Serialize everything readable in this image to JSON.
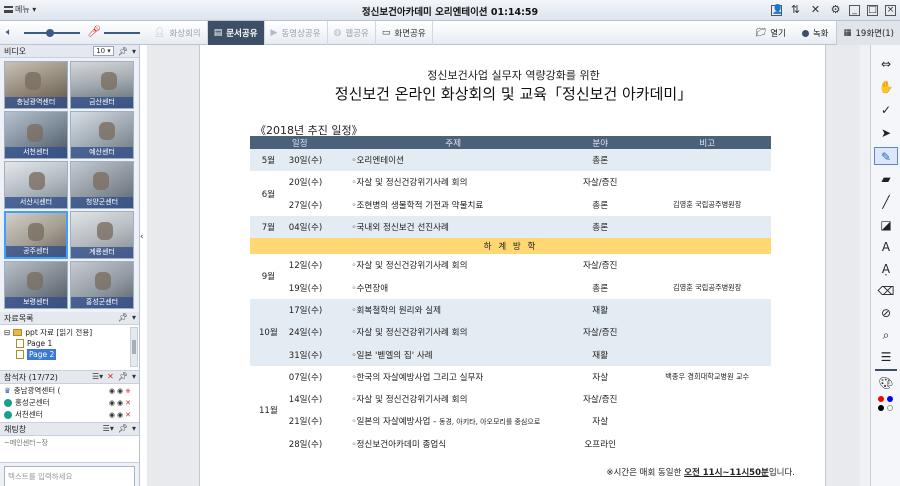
{
  "window": {
    "menu_label": "메뉴",
    "title": "정신보건아카데미 오리엔테이션 01:14:59"
  },
  "toolbar": {
    "tabs": [
      {
        "label": "화상회의",
        "icon": "person-icon"
      },
      {
        "label": "문서공유",
        "icon": "document-icon",
        "active": true
      },
      {
        "label": "동영상공유",
        "icon": "play-icon"
      },
      {
        "label": "웹공유",
        "icon": "globe-icon"
      },
      {
        "label": "화면공유",
        "icon": "monitor-icon"
      }
    ],
    "open_label": "열기",
    "record_label": "녹화",
    "page_label": "19화면(1)"
  },
  "video": {
    "header": "비디오",
    "count": "10",
    "cells": [
      "충남광역센터",
      "금산센터",
      "서천센터",
      "예산센터",
      "서산시센터",
      "청양군센터",
      "공주센터",
      "계룡센터",
      "보령센터",
      "홍성군센터"
    ]
  },
  "files": {
    "header": "자료목록",
    "folder": "ppt 자료 [읽기 전용]",
    "pages": [
      "Page 1",
      "Page 2"
    ]
  },
  "participants": {
    "header": "참석자 (17/72)",
    "items": [
      "충남광역센터 (",
      "홍성군센터",
      "서천센터"
    ]
  },
  "chat": {
    "header": "채팅창",
    "partial": "~메인센터~장",
    "placeholder": "텍스트를 입력하세요"
  },
  "document": {
    "subtitle": "정신보건사업 실무자 역량강화를 위한",
    "title": "정신보건 온라인 화상회의 및 교육「정신보건 아카데미」",
    "schedule_heading": "《2018년 추진 일정》",
    "columns": [
      "일정",
      "주제",
      "분야",
      "비고"
    ],
    "vacation": "하 계 방 학",
    "rows": [
      {
        "month": "5월",
        "date": "30일(수)",
        "topic": "◦오리엔테이션",
        "cat": "총론",
        "note": "",
        "shade": true
      },
      {
        "month": "6월",
        "date": "20일(수)",
        "topic": "◦자살 및 정신건강위기사례 회의",
        "cat": "자살/증진",
        "note": "",
        "shade": false
      },
      {
        "month": "",
        "date": "27일(수)",
        "topic": "◦조현병의 생물학적 기전과 약물치료",
        "cat": "총론",
        "note": "김영훈  국립공주병원장",
        "shade": false
      },
      {
        "month": "7월",
        "date": "04일(수)",
        "topic": "◦국내외 정신보건 선진사례",
        "cat": "총론",
        "note": "",
        "shade": true
      },
      {
        "month": "9월",
        "date": "12일(수)",
        "topic": "◦자살 및 정신건강위기사례 회의",
        "cat": "자살/증진",
        "note": "",
        "shade": false
      },
      {
        "month": "",
        "date": "19일(수)",
        "topic": "◦수면장애",
        "cat": "총론",
        "note": "김영훈  국립공주병원장",
        "shade": false
      },
      {
        "month": "10월",
        "date": "17일(수)",
        "topic": "◦회복철학의 원리와 실제",
        "cat": "재활",
        "note": "",
        "shade": true
      },
      {
        "month": "",
        "date": "24일(수)",
        "topic": "◦자살 및 정신건강위기사례 회의",
        "cat": "자살/증진",
        "note": "",
        "shade": true
      },
      {
        "month": "",
        "date": "31일(수)",
        "topic": "◦일본 '벧엘의 집' 사례",
        "cat": "재활",
        "note": "",
        "shade": true
      },
      {
        "month": "11월",
        "date": "07일(수)",
        "topic": "◦한국의 자살예방사업 그리고 실무자",
        "cat": "자살",
        "note": "백종우  경희대학교병원 교수",
        "shade": false
      },
      {
        "month": "",
        "date": "14일(수)",
        "topic": "◦자살 및 정신건강위기사례 회의",
        "cat": "자살/증진",
        "note": "",
        "shade": false
      },
      {
        "month": "",
        "date": "21일(수)",
        "topic": "◦일본의 자살예방사업 - ",
        "topic_small": "동경, 아키타, 아오모리를 중심으로",
        "cat": "자살",
        "note": "",
        "shade": false
      },
      {
        "month": "",
        "date": "28일(수)",
        "topic": "◦정신보건아카데미 종업식",
        "cat": "오프라인",
        "note": "",
        "shade": false
      }
    ],
    "note_prefix": "※시간은 매회 동일한 ",
    "note_time": "오전 11시~11시50분",
    "note_suffix": "입니다."
  },
  "colors": {
    "active_tab": "#3d4f66",
    "table_header": "#4b6179",
    "table_shade": "#e4ecf3",
    "vacation": "#ffd874",
    "video_label": "#32508c"
  },
  "palette": [
    "#ff0000",
    "#0000ff",
    "#000000",
    "#ffffff"
  ]
}
